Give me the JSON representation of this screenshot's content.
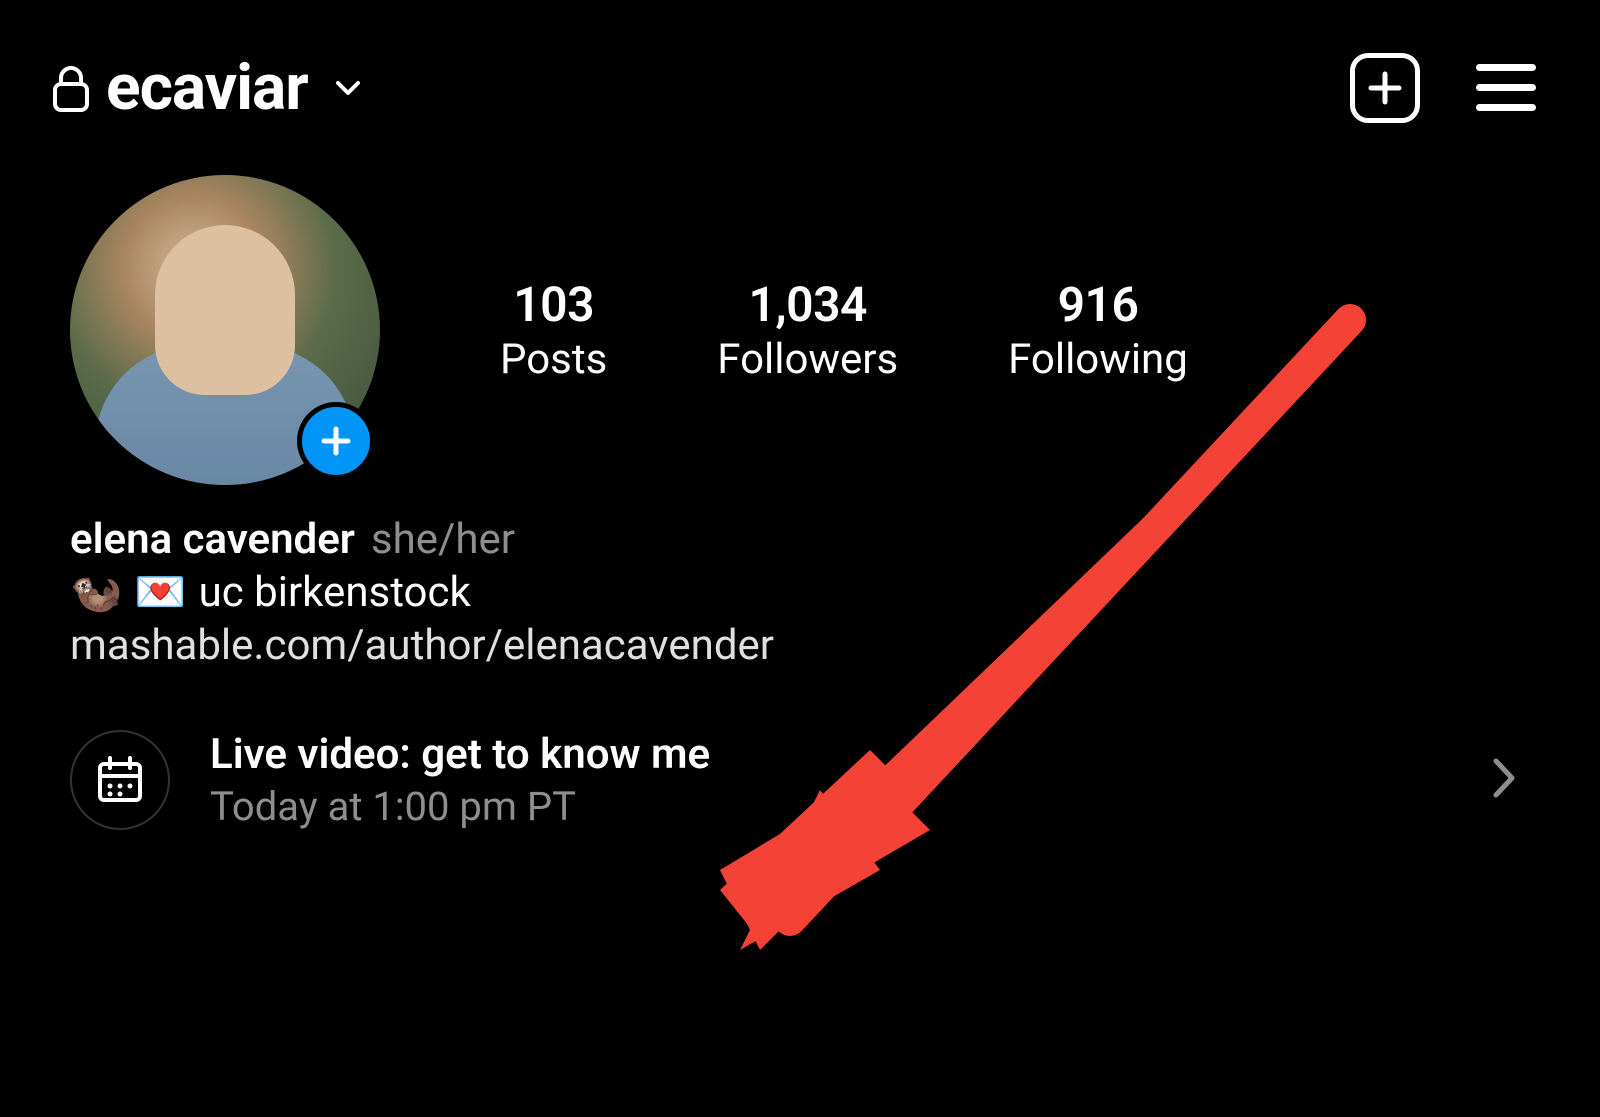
{
  "header": {
    "username": "ecaviar"
  },
  "stats": {
    "posts": {
      "count": "103",
      "label": "Posts"
    },
    "followers": {
      "count": "1,034",
      "label": "Followers"
    },
    "following": {
      "count": "916",
      "label": "Following"
    }
  },
  "bio": {
    "display_name": "elena cavender",
    "pronouns": "she/her",
    "emoji1": "🦦",
    "emoji2": "💌",
    "bio_text": "uc birkenstock",
    "link": "mashable.com/author/elenacavender"
  },
  "event": {
    "title": "Live video: get to know me",
    "time": "Today at 1:00 pm PT"
  },
  "colors": {
    "accent_blue": "#0095f6",
    "annotation_red": "#f44336"
  }
}
